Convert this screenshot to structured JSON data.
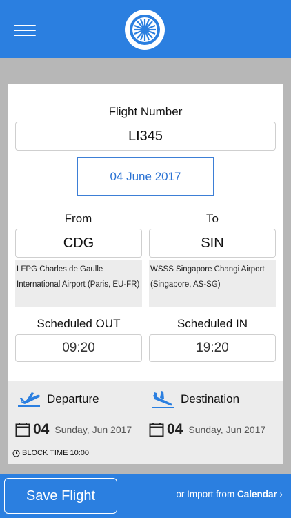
{
  "header": {
    "menu_icon": "hamburger-icon",
    "logo_icon": "turbine-logo-icon"
  },
  "form": {
    "flight_number_label": "Flight Number",
    "flight_number_value": "LI345",
    "date_value": "04 June 2017",
    "from_label": "From",
    "to_label": "To",
    "from_code": "CDG",
    "to_code": "SIN",
    "from_airport_line1": "LFPG Charles de Gaulle",
    "from_airport_line2": "International Airport (Paris, EU-FR)",
    "to_airport_line1": "WSSS Singapore Changi Airport",
    "to_airport_line2": "(Singapore, AS-SG)",
    "scheduled_out_label": "Scheduled OUT",
    "scheduled_in_label": "Scheduled IN",
    "scheduled_out_value": "09:20",
    "scheduled_in_value": "19:20"
  },
  "legs": {
    "departure_label": "Departure",
    "destination_label": "Destination",
    "departure_day": "04",
    "departure_date_text": "Sunday, Jun 2017",
    "destination_day": "04",
    "destination_date_text": "Sunday, Jun 2017",
    "block_time": "BLOCK TIME 10:00"
  },
  "footer": {
    "save_label": "Save Flight",
    "import_prefix": "or Import from",
    "import_link": "Calendar",
    "import_chevron": "›"
  },
  "colors": {
    "accent": "#2b7fe0",
    "date_text": "#2b73d4",
    "background": "#b7b7b7"
  }
}
